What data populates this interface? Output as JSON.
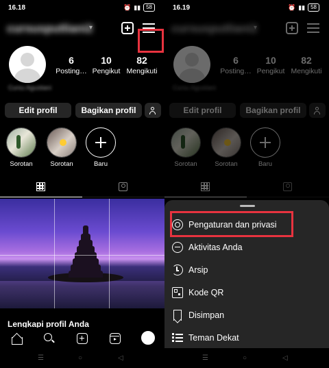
{
  "colors": {
    "background": "#000000",
    "button_bg": "#262626",
    "sheet_bg": "#262626",
    "highlight": "#e8333f"
  },
  "left": {
    "status": {
      "time": "16.18",
      "battery": "58"
    },
    "profile": {
      "username": "cursusputliani2",
      "bio_name": "Cursu Agustiani",
      "stats": [
        {
          "value": "6",
          "label": "Posting…"
        },
        {
          "value": "10",
          "label": "Pengikut"
        },
        {
          "value": "82",
          "label": "Mengikuti"
        }
      ],
      "buttons": {
        "edit": "Edit profil",
        "share": "Bagikan profil"
      },
      "highlights": [
        {
          "label": "Sorotan"
        },
        {
          "label": "Sorotan"
        },
        {
          "label": "Baru"
        }
      ]
    },
    "banner": {
      "title": "Lengkapi profil Anda"
    }
  },
  "right": {
    "status": {
      "time": "16.19",
      "battery": "58"
    },
    "profile": {
      "username": "cursusputliani2",
      "bio_name": "Cursu Agustiani",
      "stats": [
        {
          "value": "6",
          "label": "Posting…"
        },
        {
          "value": "10",
          "label": "Pengikut"
        },
        {
          "value": "82",
          "label": "Mengikuti"
        }
      ],
      "buttons": {
        "edit": "Edit profil",
        "share": "Bagikan profil"
      },
      "highlights": [
        {
          "label": "Sorotan"
        },
        {
          "label": "Sorotan"
        },
        {
          "label": "Baru"
        }
      ]
    },
    "menu": {
      "items": [
        {
          "label": "Pengaturan dan privasi",
          "icon": "gear-icon"
        },
        {
          "label": "Aktivitas Anda",
          "icon": "activity-icon"
        },
        {
          "label": "Arsip",
          "icon": "archive-icon"
        },
        {
          "label": "Kode QR",
          "icon": "qr-code-icon"
        },
        {
          "label": "Disimpan",
          "icon": "bookmark-icon"
        },
        {
          "label": "Teman Dekat",
          "icon": "list-icon"
        }
      ]
    }
  },
  "sysnav": {
    "menu": "☰",
    "home": "○",
    "back": "◁"
  }
}
